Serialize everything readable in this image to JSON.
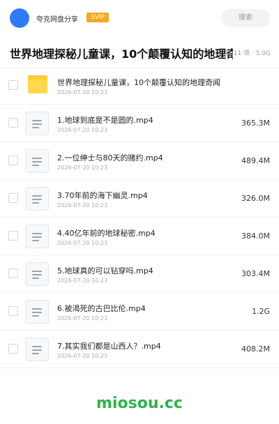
{
  "header": {
    "app_name": "夸克网盘分享",
    "badge": "SVIP",
    "search_placeholder": "搜索"
  },
  "title": {
    "text": "世界地理探秘儿童课，10个颠覆认知的地理奇闻",
    "meta": "共 11 项 · 5.0G"
  },
  "items": [
    {
      "type": "folder",
      "name": "世界地理探秘儿童课，10个颠覆认知的地理奇闻",
      "date": "2026-07-20 10:23",
      "size": ""
    },
    {
      "type": "file",
      "name": "1.地球到底是不是圆的.mp4",
      "date": "2026-07-20 10:23",
      "size": "365.3M"
    },
    {
      "type": "file",
      "name": "2.一位绅士与80天的赌约.mp4",
      "date": "2026-07-20 10:23",
      "size": "489.4M"
    },
    {
      "type": "file",
      "name": "3.70年前的海下幽灵.mp4",
      "date": "2026-07-20 10:23",
      "size": "326.0M"
    },
    {
      "type": "file",
      "name": "4.40亿年前的地球秘密.mp4",
      "date": "2026-07-20 10:23",
      "size": "384.0M"
    },
    {
      "type": "file",
      "name": "5.地球真的可以钻穿吗.mp4",
      "date": "2026-07-20 10:23",
      "size": "303.4M"
    },
    {
      "type": "file",
      "name": "6.被渴死的古巴比伦.mp4",
      "date": "2026-07-20 10:23",
      "size": "1.2G"
    },
    {
      "type": "file",
      "name": "7.其实我们都是山西人？.mp4",
      "date": "2026-07-20 10:23",
      "size": "408.2M"
    }
  ],
  "footer": {
    "watermark": "miosou.cc"
  },
  "colors": {
    "accent": "#2f7bf5",
    "badge": "#f5a623",
    "folder": "#ffcc33",
    "watermark": "#2fb34a"
  },
  "icons": {
    "folder": "folder-icon",
    "file": "video-file-icon"
  }
}
